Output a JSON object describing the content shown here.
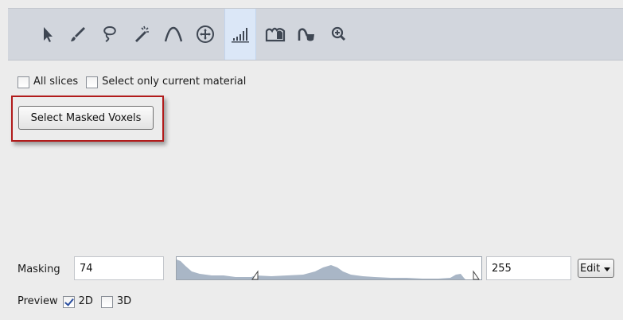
{
  "toolbar": {
    "tools": [
      {
        "icon": "pointer-arrow-icon",
        "active": false
      },
      {
        "icon": "brush-icon",
        "active": false
      },
      {
        "icon": "lasso-icon",
        "active": false
      },
      {
        "icon": "magic-wand-icon",
        "active": false
      },
      {
        "icon": "curve-icon",
        "active": false
      },
      {
        "icon": "move-crosshair-icon",
        "active": false
      },
      {
        "icon": "threshold-histogram-icon",
        "active": true
      },
      {
        "icon": "region-grow-icon",
        "active": false
      },
      {
        "icon": "blow-tool-icon",
        "active": false
      },
      {
        "icon": "zoom-in-icon",
        "active": false
      }
    ]
  },
  "options": {
    "all_slices": {
      "label": "All slices",
      "checked": false
    },
    "current_material": {
      "label": "Select only current material",
      "checked": false
    }
  },
  "actions": {
    "select_masked_label": "Select Masked Voxels"
  },
  "masking": {
    "label": "Masking",
    "min_value": "74",
    "max_value": "255",
    "edit_label": "Edit"
  },
  "preview": {
    "label": "Preview",
    "option_2d": {
      "label": "2D",
      "checked": true
    },
    "option_3d": {
      "label": "3D",
      "checked": false
    }
  },
  "colors": {
    "highlight_border": "#b11b1b",
    "toolbar_bg": "#d2d6dd",
    "active_tool_bg": "#dbe7f7",
    "histogram_fill": "#a9b6c6"
  }
}
